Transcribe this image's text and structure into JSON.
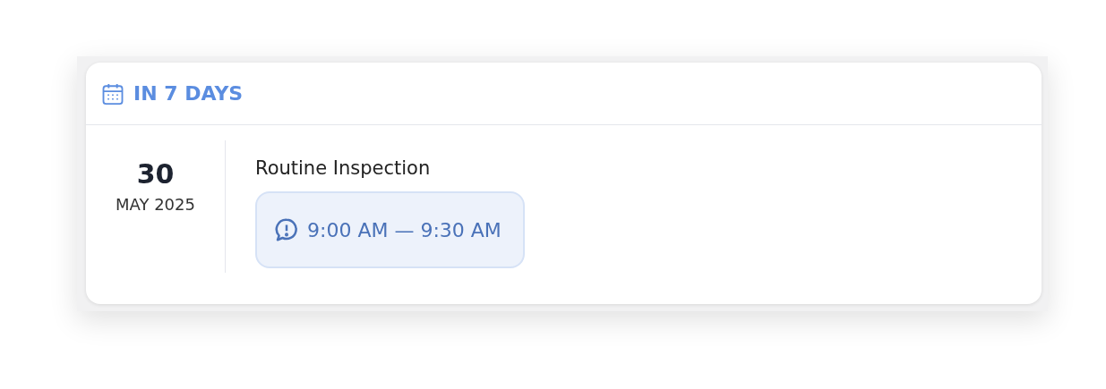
{
  "header": {
    "title": "IN 7 DAYS"
  },
  "events": [
    {
      "day": "30",
      "month_year": "MAY 2025",
      "title": "Routine Inspection",
      "time": "9:00 AM — 9:30 AM"
    }
  ]
}
